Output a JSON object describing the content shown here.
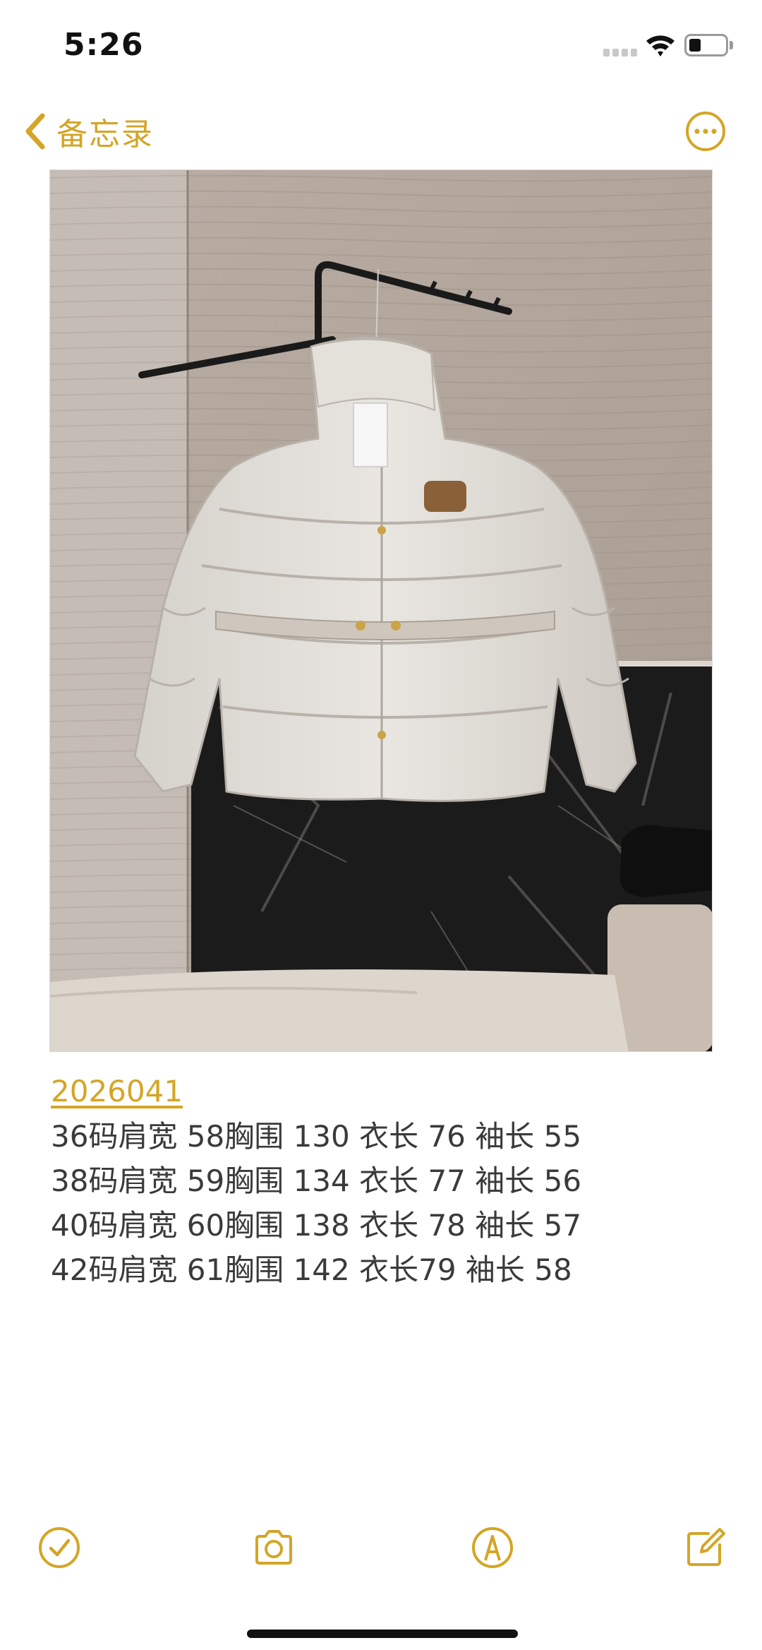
{
  "status_bar": {
    "time": "5:26"
  },
  "nav": {
    "back_label": "备忘录",
    "more_icon": "ellipsis-circle-icon"
  },
  "note": {
    "image_subject": "photo of a cream belted puffer down jacket hanging on a wall hook",
    "code": "2026041",
    "lines": [
      "36码肩宽 58胸围 130 衣长 76 袖长 55",
      "38码肩宽 59胸围 134 衣长 77 袖长 56",
      "40码肩宽 60胸围 138 衣长 78 袖长 57",
      "42码肩宽 61胸围 142 衣长79 袖长 58"
    ]
  },
  "toolbar": {
    "icons": [
      "checklist-icon",
      "camera-icon",
      "markup-pen-icon",
      "compose-icon"
    ]
  },
  "colors": {
    "accent": "#d4a526",
    "text": "#3a3a3a"
  }
}
